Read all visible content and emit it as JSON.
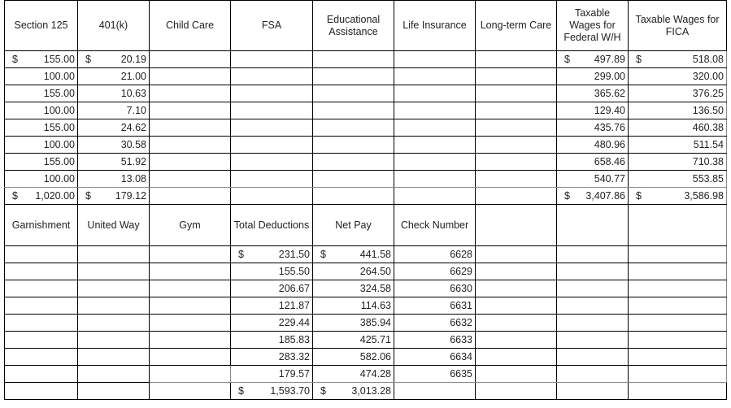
{
  "upper_table": {
    "headers": [
      "Section 125",
      "401(k)",
      "Child Care",
      "FSA",
      "Educational Assistance",
      "Life Insurance",
      "Long-term Care",
      "Taxable Wages for Federal W/H",
      "Taxable Wages for FICA"
    ],
    "currency_symbol": "$",
    "rows": [
      {
        "section125": "155.00",
        "k401": "20.19",
        "child_care": "",
        "fsa": "",
        "edu": "",
        "life": "",
        "ltc": "",
        "fed_wh": "497.89",
        "fica": "518.08"
      },
      {
        "section125": "100.00",
        "k401": "21.00",
        "child_care": "",
        "fsa": "",
        "edu": "",
        "life": "",
        "ltc": "",
        "fed_wh": "299.00",
        "fica": "320.00"
      },
      {
        "section125": "155.00",
        "k401": "10.63",
        "child_care": "",
        "fsa": "",
        "edu": "",
        "life": "",
        "ltc": "",
        "fed_wh": "365.62",
        "fica": "376.25"
      },
      {
        "section125": "100.00",
        "k401": "7.10",
        "child_care": "",
        "fsa": "",
        "edu": "",
        "life": "",
        "ltc": "",
        "fed_wh": "129.40",
        "fica": "136.50"
      },
      {
        "section125": "155.00",
        "k401": "24.62",
        "child_care": "",
        "fsa": "",
        "edu": "",
        "life": "",
        "ltc": "",
        "fed_wh": "435.76",
        "fica": "460.38"
      },
      {
        "section125": "100.00",
        "k401": "30.58",
        "child_care": "",
        "fsa": "",
        "edu": "",
        "life": "",
        "ltc": "",
        "fed_wh": "480.96",
        "fica": "511.54"
      },
      {
        "section125": "155.00",
        "k401": "51.92",
        "child_care": "",
        "fsa": "",
        "edu": "",
        "life": "",
        "ltc": "",
        "fed_wh": "658.46",
        "fica": "710.38"
      },
      {
        "section125": "100.00",
        "k401": "13.08",
        "child_care": "",
        "fsa": "",
        "edu": "",
        "life": "",
        "ltc": "",
        "fed_wh": "540.77",
        "fica": "553.85"
      }
    ],
    "totals": {
      "section125": "1,020.00",
      "k401": "179.12",
      "fed_wh": "3,407.86",
      "fica": "3,586.98"
    }
  },
  "lower_table": {
    "headers": [
      "Garnishment",
      "United Way",
      "Gym",
      "Total Deductions",
      "Net Pay",
      "Check Number",
      "",
      "",
      ""
    ],
    "currency_symbol": "$",
    "rows": [
      {
        "total_deductions": "231.50",
        "net_pay": "441.58",
        "check_number": "6628"
      },
      {
        "total_deductions": "155.50",
        "net_pay": "264.50",
        "check_number": "6629"
      },
      {
        "total_deductions": "206.67",
        "net_pay": "324.58",
        "check_number": "6630"
      },
      {
        "total_deductions": "121.87",
        "net_pay": "114.63",
        "check_number": "6631"
      },
      {
        "total_deductions": "229.44",
        "net_pay": "385.94",
        "check_number": "6632"
      },
      {
        "total_deductions": "185.83",
        "net_pay": "425.71",
        "check_number": "6633"
      },
      {
        "total_deductions": "283.32",
        "net_pay": "582.06",
        "check_number": "6634"
      },
      {
        "total_deductions": "179.57",
        "net_pay": "474.28",
        "check_number": "6635"
      }
    ],
    "totals": {
      "total_deductions": "1,593.70",
      "net_pay": "3,013.28"
    }
  }
}
